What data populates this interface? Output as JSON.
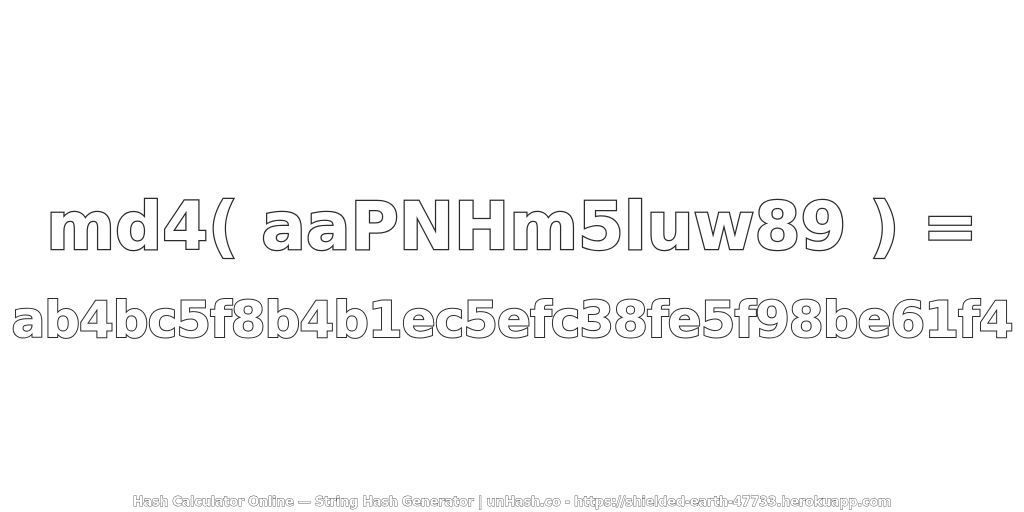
{
  "hash_expression": "md4( aaPNHm5luw89 ) =",
  "hash_result": "ab4bc5f8b4b1ec5efc38fe5f98be61f4",
  "footer": "Hash Calculator Online — String Hash Generator | unHash.co - https://shielded-earth-47733.herokuapp.com"
}
